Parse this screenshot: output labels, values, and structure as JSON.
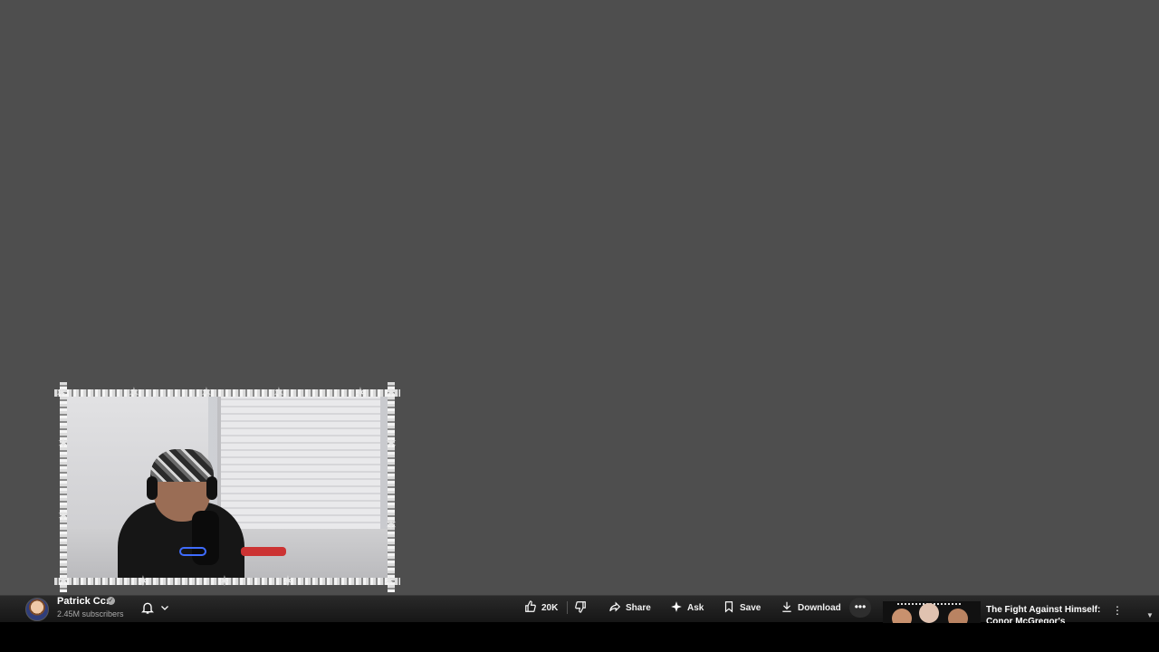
{
  "channel": {
    "name": "Patrick Cc:",
    "subscribers": "2.45M subscribers"
  },
  "actions": {
    "like_count": "20K",
    "share_label": "Share",
    "ask_label": "Ask",
    "save_label": "Save",
    "download_label": "Download",
    "more_label": "•••"
  },
  "recommendation": {
    "title": "The Fight Against Himself: Conor McGregor's Downfall"
  },
  "icons": {
    "bell": "bell-icon",
    "chevron": "chevron-down-icon",
    "like": "thumbs-up-icon",
    "dislike": "thumbs-down-icon",
    "share": "share-arrow-icon",
    "ask": "sparkle-icon",
    "save": "bookmark-icon",
    "download": "download-icon",
    "more": "more-horizontal-icon",
    "kebab": "more-vertical-icon"
  },
  "colors": {
    "video_background": "#4e4e4e",
    "bar_background": "#1f1f1f",
    "text_primary": "#ffffff",
    "text_secondary": "#aaaaaa"
  }
}
